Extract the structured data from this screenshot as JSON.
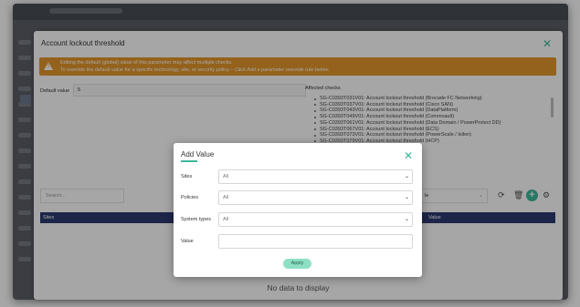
{
  "modal": {
    "title": "Account lockout threshold",
    "warning_line1": "Editing the default (global) value of this parameter may affect multiple checks.",
    "warning_line2_a": "To override the default value for a specific technology, site, or security policy – ",
    "warning_line2_b": "Click Add a parameter override rule below.",
    "default_value_label": "Default value",
    "default_value": "5",
    "affected_label": "Affected checks",
    "affected_checks": [
      "SG-C0393T031V01: Account lockout threshold (Brocade FC Networking)",
      "SG-C0393T037V01: Account lockout threshold (Cisco SAN)",
      "SG-C0393T043V01: Account lockout threshold (DataPlatform)",
      "SG-C0393T049V01: Account lockout threshold (Commvault)",
      "SG-C0393T061V01: Account lockout threshold (Data Domain / PowerProtect DD)",
      "SG-C0393T067V01: Account lockout threshold (ECS)",
      "SG-C0393T073V01: Account lockout threshold (PowerScale / Isilon)",
      "SG-C0393T079V01: Account lockout threshold (HCP)"
    ],
    "search_placeholder": "Search...",
    "filter_value": "le",
    "table": {
      "col1": "Sites",
      "col2": "Value"
    },
    "no_data": "No data to display"
  },
  "dialog": {
    "title": "Add Value",
    "fields": {
      "sites_label": "Sites",
      "sites_value": "All",
      "policies_label": "Policies",
      "policies_value": "All",
      "system_types_label": "System types",
      "system_types_value": "All",
      "value_label": "Value"
    },
    "apply_label": "Apply"
  },
  "colors": {
    "accent": "#3cb99a",
    "warning": "#e4972c",
    "table_header": "#2d3b71"
  }
}
